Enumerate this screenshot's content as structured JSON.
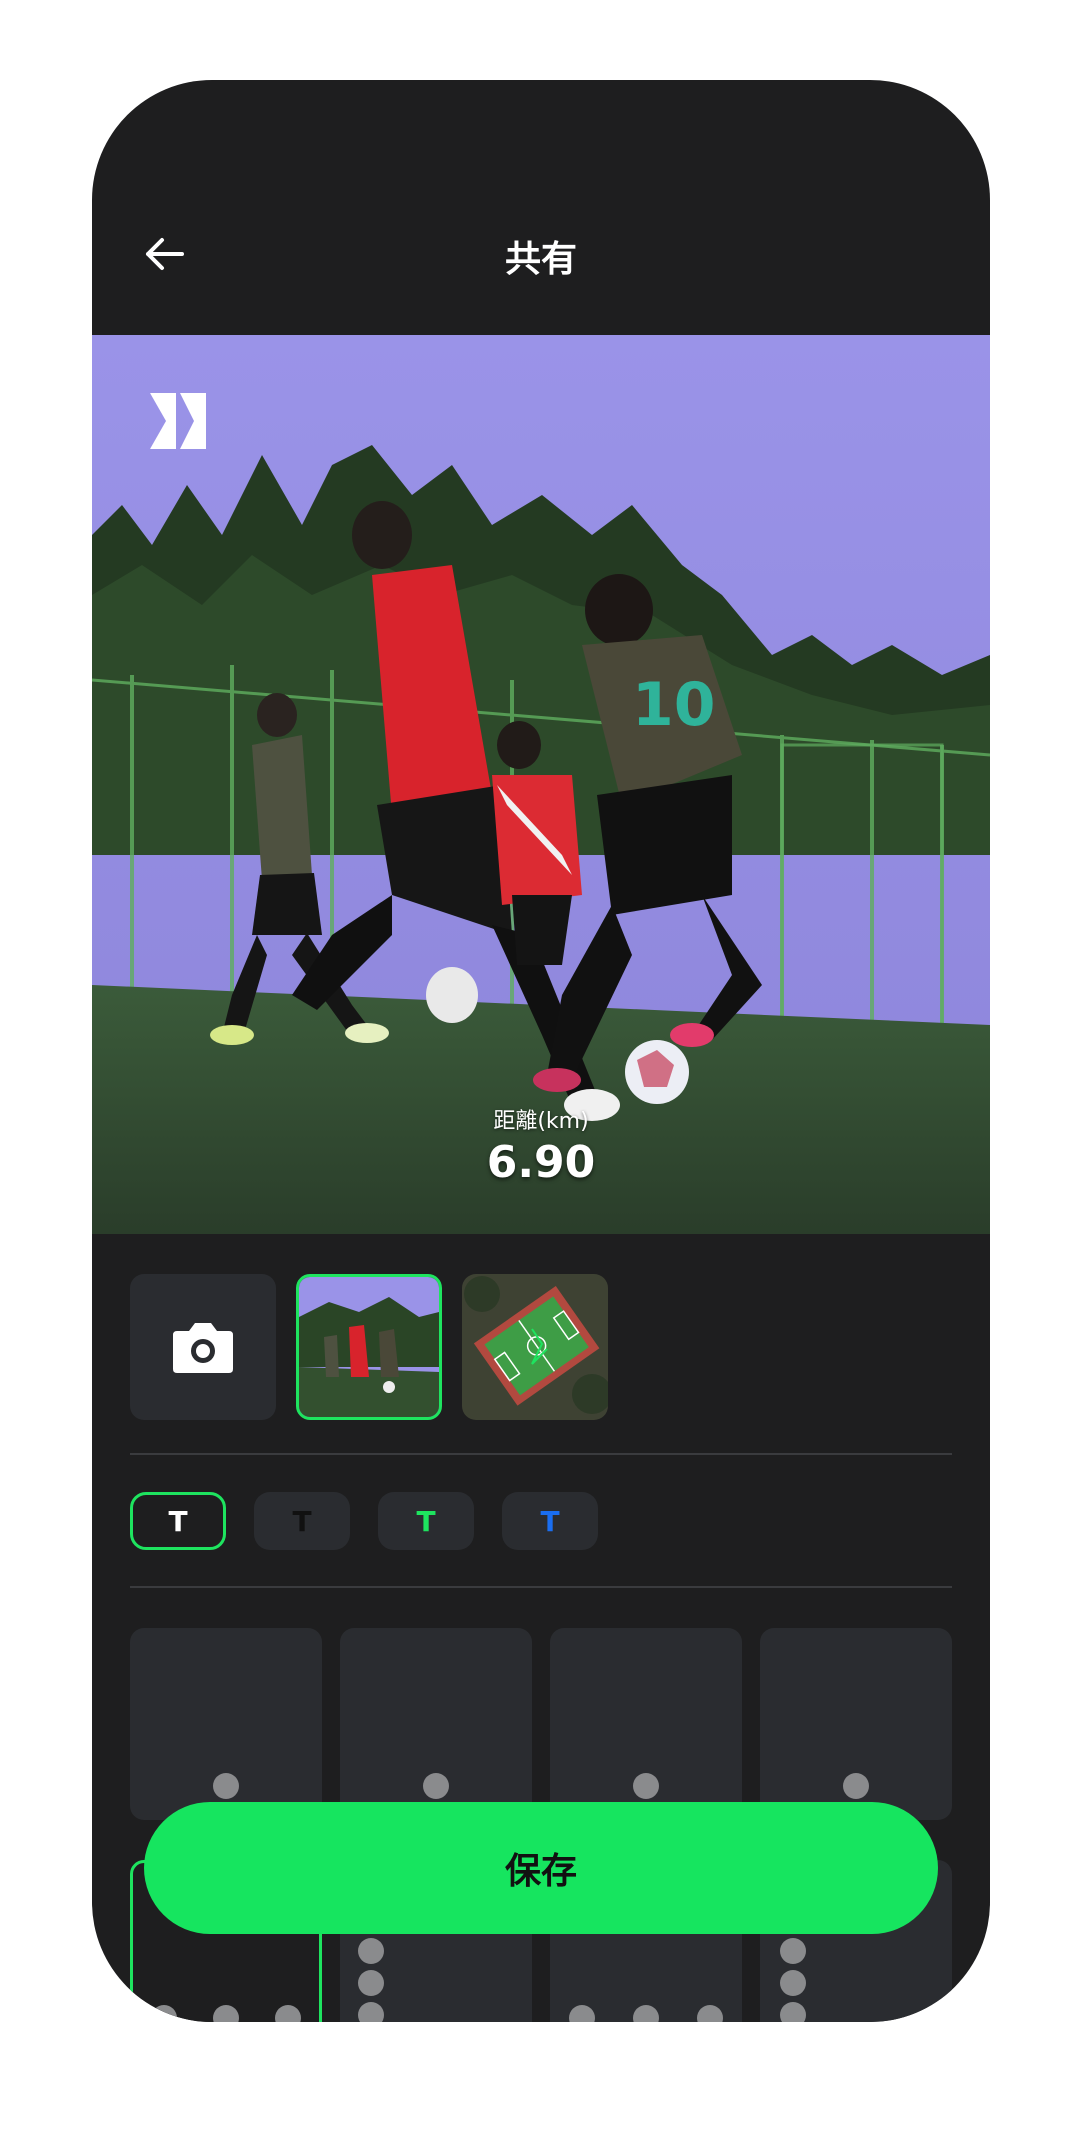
{
  "header": {
    "title": "共有"
  },
  "preview": {
    "metric_label": "距離(km)",
    "metric_value": "6.90"
  },
  "backgrounds": [
    {
      "type": "camera"
    },
    {
      "type": "photo-soccer",
      "selected": true
    },
    {
      "type": "photo-field",
      "selected": false
    }
  ],
  "text_styles": [
    {
      "label": "T",
      "color": "#ffffff",
      "selected": true
    },
    {
      "label": "T",
      "color": "#111111",
      "selected": false
    },
    {
      "label": "T",
      "color": "#1ee45f",
      "selected": false
    },
    {
      "label": "T",
      "color": "#1a6ef0",
      "selected": false
    }
  ],
  "save_label": "保存",
  "colors": {
    "accent": "#16e55f",
    "background": "#1e1e1f",
    "card": "#2a2c30"
  }
}
